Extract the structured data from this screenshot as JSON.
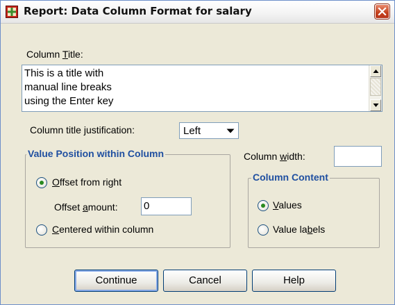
{
  "window": {
    "title": "Report: Data Column Format for salary"
  },
  "column_title": {
    "label_pre": "Column ",
    "label_mn": "T",
    "label_post": "itle:",
    "lines": [
      "This is a title with",
      "manual line breaks",
      "using the Enter key"
    ]
  },
  "justification": {
    "label_pre": "Column title ",
    "label_mn": "j",
    "label_post": "ustification:",
    "value": "Left"
  },
  "value_position": {
    "title": "Value Position within Column",
    "offset_pre": "",
    "offset_mn": "O",
    "offset_post": "ffset from right",
    "offset_checked": true,
    "amount_pre": "Offset ",
    "amount_mn": "a",
    "amount_post": "mount:",
    "amount_value": "0",
    "centered_pre": "",
    "centered_mn": "C",
    "centered_post": "entered within column",
    "centered_checked": false
  },
  "column_width": {
    "label_pre": "Column ",
    "label_mn": "w",
    "label_post": "idth:",
    "value": ""
  },
  "column_content": {
    "title": "Column Content",
    "values_pre": "",
    "values_mn": "V",
    "values_post": "alues",
    "values_checked": true,
    "labels_pre": "Value la",
    "labels_mn": "b",
    "labels_post": "els",
    "labels_checked": false
  },
  "buttons": {
    "continue": "Continue",
    "cancel": "Cancel",
    "help": "Help"
  }
}
